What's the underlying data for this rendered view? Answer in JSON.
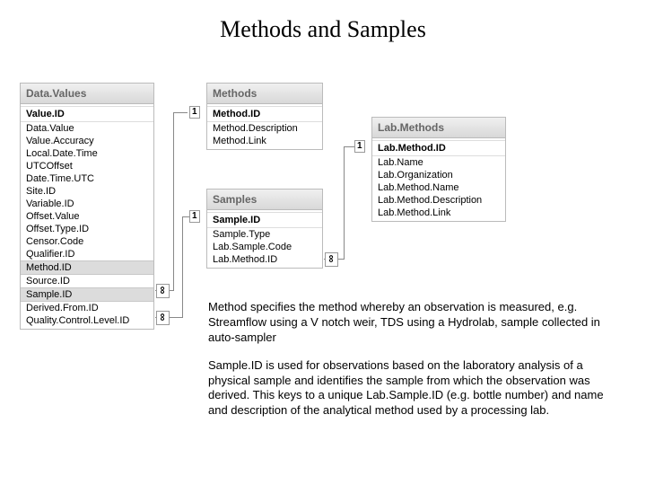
{
  "title": "Methods and Samples",
  "tables": {
    "dataValues": {
      "header": "Data.Values",
      "pk": "Value.ID",
      "rows": [
        "Data.Value",
        "Value.Accuracy",
        "Local.Date.Time",
        "UTCOffset",
        "Date.Time.UTC",
        "Site.ID",
        "Variable.ID",
        "Offset.Value",
        "Offset.Type.ID",
        "Censor.Code",
        "Qualifier.ID",
        "Method.ID",
        "Source.ID",
        "Sample.ID",
        "Derived.From.ID",
        "Quality.Control.Level.ID"
      ],
      "highlights": [
        "Method.ID",
        "Sample.ID"
      ]
    },
    "methods": {
      "header": "Methods",
      "pk": "Method.ID",
      "rows": [
        "Method.Description",
        "Method.Link"
      ]
    },
    "samples": {
      "header": "Samples",
      "pk": "Sample.ID",
      "rows": [
        "Sample.Type",
        "Lab.Sample.Code",
        "Lab.Method.ID"
      ]
    },
    "labMethods": {
      "header": "Lab.Methods",
      "pk": "Lab.Method.ID",
      "rows": [
        "Lab.Name",
        "Lab.Organization",
        "Lab.Method.Name",
        "Lab.Method.Description",
        "Lab.Method.Link"
      ]
    }
  },
  "cards": {
    "one": "1",
    "many": "∞"
  },
  "paragraphs": {
    "p1": "Method specifies the method whereby an observation is measured, e.g. Streamflow using a V notch weir, TDS using a Hydrolab, sample collected in auto-sampler",
    "p2": "Sample.ID is used for observations based on the laboratory analysis of a physical sample and identifies the sample from which the observation was derived. This keys to a unique Lab.Sample.ID (e.g. bottle number) and name and description of the analytical method used by a processing lab."
  }
}
